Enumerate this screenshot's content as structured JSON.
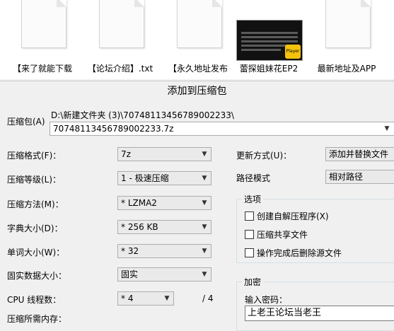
{
  "explorer": {
    "files": [
      {
        "name": "【来了就能下载",
        "type": "text-document"
      },
      {
        "name": "【论坛介绍】.txt",
        "type": "text-document"
      },
      {
        "name": "【永久地址发布",
        "type": "text-document"
      },
      {
        "name": "蕾探姐妹花EP2",
        "type": "video",
        "badge": "Player"
      },
      {
        "name": "最新地址及APP",
        "type": "text-document"
      }
    ]
  },
  "dialog": {
    "title": "添加到压缩包",
    "archive": {
      "label": "压缩包(A)",
      "path": "D:\\新建文件夹 (3)\\70748113456789002233\\",
      "filename": "70748113456789002233.7z"
    },
    "format": {
      "label": "压缩格式(F)：",
      "value": "7z"
    },
    "level": {
      "label": "压缩等级(L)：",
      "value": "1 - 极速压缩"
    },
    "method": {
      "label": "压缩方法(M)：",
      "value": "* LZMA2"
    },
    "dict": {
      "label": "字典大小(D)：",
      "value": "* 256 KB"
    },
    "word": {
      "label": "单词大小(W)：",
      "value": "* 32"
    },
    "solid": {
      "label": "固实数据大小：",
      "value": "固实"
    },
    "threads": {
      "label": "CPU 线程数：",
      "value": "* 4",
      "max": "/ 4"
    },
    "memory": {
      "label": "压缩所需内存："
    },
    "update": {
      "label": "更新方式(U)：",
      "value": "添加并替换文件"
    },
    "pathmode": {
      "label": "路径模式",
      "value": "相对路径"
    },
    "options": {
      "legend": "选项",
      "items": [
        "创建自解压程序(X)",
        "压缩共享文件",
        "操作完成后删除源文件"
      ]
    },
    "encrypt": {
      "legend": "加密",
      "prompt": "输入密码：",
      "password": "上老王论坛当老王"
    }
  }
}
